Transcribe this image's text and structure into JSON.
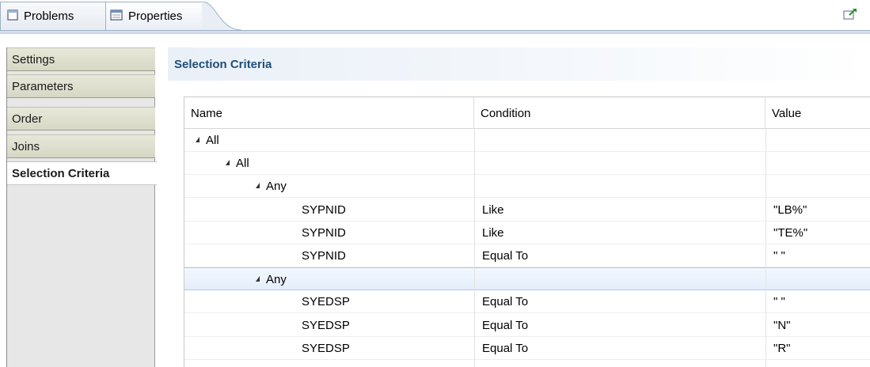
{
  "tabs": [
    {
      "label": "Problems",
      "icon": "problems-icon"
    },
    {
      "label": "Properties",
      "icon": "properties-icon"
    }
  ],
  "categories": [
    {
      "label": "Settings",
      "active": false
    },
    {
      "label": "Parameters",
      "active": false
    },
    {
      "label": "Order",
      "active": false
    },
    {
      "label": "Joins",
      "active": false
    },
    {
      "label": "Selection Criteria",
      "active": true
    }
  ],
  "section": {
    "title": "Selection Criteria"
  },
  "table": {
    "columns": [
      "Name",
      "Condition",
      "Value"
    ],
    "rows": [
      {
        "level": 0,
        "expandable": true,
        "name": "All",
        "condition": "",
        "value": ""
      },
      {
        "level": 1,
        "expandable": true,
        "name": "All",
        "condition": "",
        "value": ""
      },
      {
        "level": 2,
        "expandable": true,
        "name": "Any",
        "condition": "",
        "value": ""
      },
      {
        "level": 3,
        "expandable": false,
        "name": "SYPNID",
        "condition": "Like",
        "value": "\"LB%\""
      },
      {
        "level": 3,
        "expandable": false,
        "name": "SYPNID",
        "condition": "Like",
        "value": "\"TE%\""
      },
      {
        "level": 3,
        "expandable": false,
        "name": "SYPNID",
        "condition": "Equal To",
        "value": "\" \""
      },
      {
        "level": 2,
        "expandable": true,
        "name": "Any",
        "condition": "",
        "value": "",
        "selected": true
      },
      {
        "level": 3,
        "expandable": false,
        "name": "SYEDSP",
        "condition": "Equal To",
        "value": "\" \""
      },
      {
        "level": 3,
        "expandable": false,
        "name": "SYEDSP",
        "condition": "Equal To",
        "value": "\"N\""
      },
      {
        "level": 3,
        "expandable": false,
        "name": "SYEDSP",
        "condition": "Equal To",
        "value": "\"R\""
      }
    ]
  }
}
